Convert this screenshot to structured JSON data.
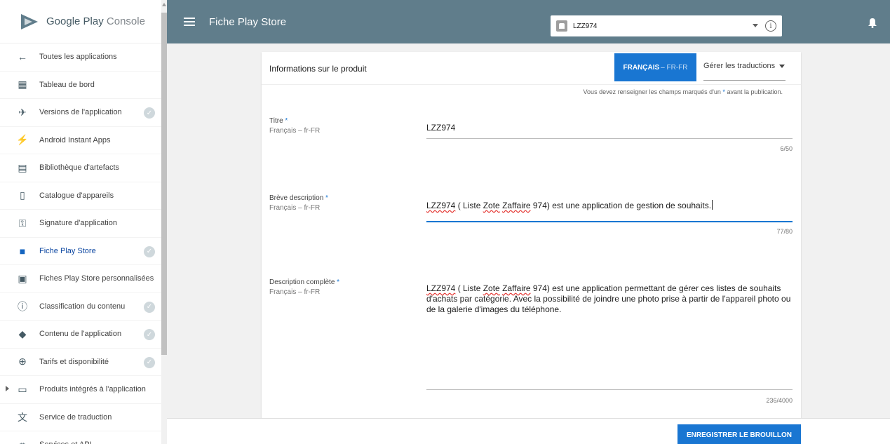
{
  "brand": {
    "name_google": "Google Play",
    "name_console": "Console"
  },
  "sidebar": {
    "items": [
      {
        "label": "Toutes les applications",
        "icon": "arrow-left-icon",
        "checked": false
      },
      {
        "label": "Tableau de bord",
        "icon": "dashboard-icon",
        "checked": false
      },
      {
        "label": "Versions de l'application",
        "icon": "rocket-icon",
        "checked": true
      },
      {
        "label": "Android Instant Apps",
        "icon": "bolt-icon",
        "checked": false
      },
      {
        "label": "Bibliothèque d'artefacts",
        "icon": "library-icon",
        "checked": false
      },
      {
        "label": "Catalogue d'appareils",
        "icon": "device-icon",
        "checked": false
      },
      {
        "label": "Signature d'application",
        "icon": "key-icon",
        "checked": false
      },
      {
        "label": "Fiche Play Store",
        "icon": "store-icon",
        "checked": true,
        "active": true
      },
      {
        "label": "Fiches Play Store personnalisées",
        "icon": "store-custom-icon",
        "checked": false
      },
      {
        "label": "Classification du contenu",
        "icon": "rating-icon",
        "checked": true
      },
      {
        "label": "Contenu de l'application",
        "icon": "shield-icon",
        "checked": true
      },
      {
        "label": "Tarifs et disponibilité",
        "icon": "globe-icon",
        "checked": true
      },
      {
        "label": "Produits intégrés à l'application",
        "icon": "card-icon",
        "checked": false,
        "expandable": true
      },
      {
        "label": "Service de traduction",
        "icon": "translate-icon",
        "checked": false
      },
      {
        "label": "Services et API",
        "icon": "api-icon",
        "checked": false
      }
    ]
  },
  "topbar": {
    "title": "Fiche Play Store",
    "app_selector": {
      "value": "LZZ974"
    },
    "info_symbol": "i"
  },
  "card": {
    "title": "Informations sur le produit",
    "language_button": {
      "label": "FRANÇAIS",
      "code": "– FR-FR"
    },
    "manage_translations": "Gérer les traductions",
    "required_note_before": "Vous devez renseigner les champs marqués d'un",
    "required_note_after": "avant la publication.",
    "required_star": "*"
  },
  "fields": {
    "title": {
      "label": "Titre",
      "lang": "Français – fr-FR",
      "value": "LZZ974",
      "counter": "6/50"
    },
    "short_desc": {
      "label": "Brève description",
      "lang": "Français – fr-FR",
      "value_parts": [
        "LZZ974",
        " ( Liste ",
        "Zote",
        " ",
        "Zaffaire",
        " 974) est une application de gestion de souhaits."
      ],
      "counter": "77/80"
    },
    "full_desc": {
      "label": "Description complète",
      "lang": "Français – fr-FR",
      "value_parts": [
        "LZZ974",
        " ( Liste ",
        "Zote",
        " ",
        "Zaffaire",
        " 974) est une application permettant de gérer ces listes de souhaits d'achats par catégorie. Avec la possibilité de joindre une photo prise à partir de l'appareil photo ou de la galerie d'images du téléphone."
      ],
      "counter": "236/4000"
    }
  },
  "bottombar": {
    "save_label": "ENREGISTRER LE BROUILLON"
  },
  "colors": {
    "header": "#607d8b",
    "accent": "#1976d2",
    "check": "#cfd8dc"
  }
}
